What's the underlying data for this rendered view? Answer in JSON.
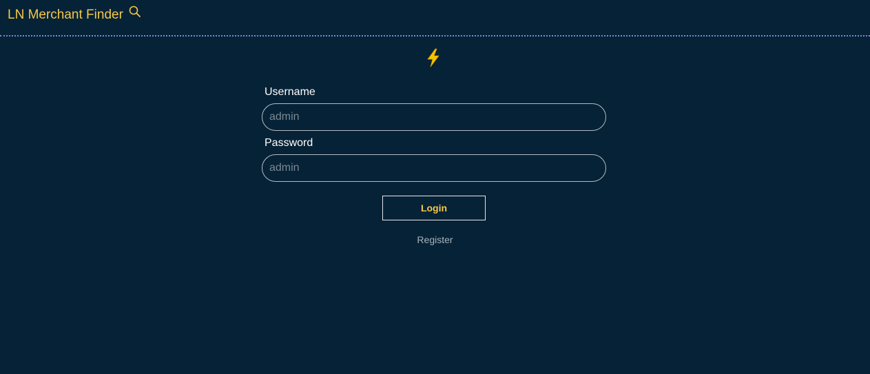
{
  "header": {
    "brand": "LN Merchant Finder",
    "brand_icon": "search-icon",
    "brand_color": "#f5c84a",
    "divider_color": "#8a86d6"
  },
  "page": {
    "background": "#062236",
    "hero_icon": "lightning-bolt-icon"
  },
  "form": {
    "username_label": "Username",
    "username_placeholder": "admin",
    "username_value": "",
    "password_label": "Password",
    "password_placeholder": "admin",
    "password_value": "",
    "login_label": "Login",
    "register_label": "Register"
  }
}
